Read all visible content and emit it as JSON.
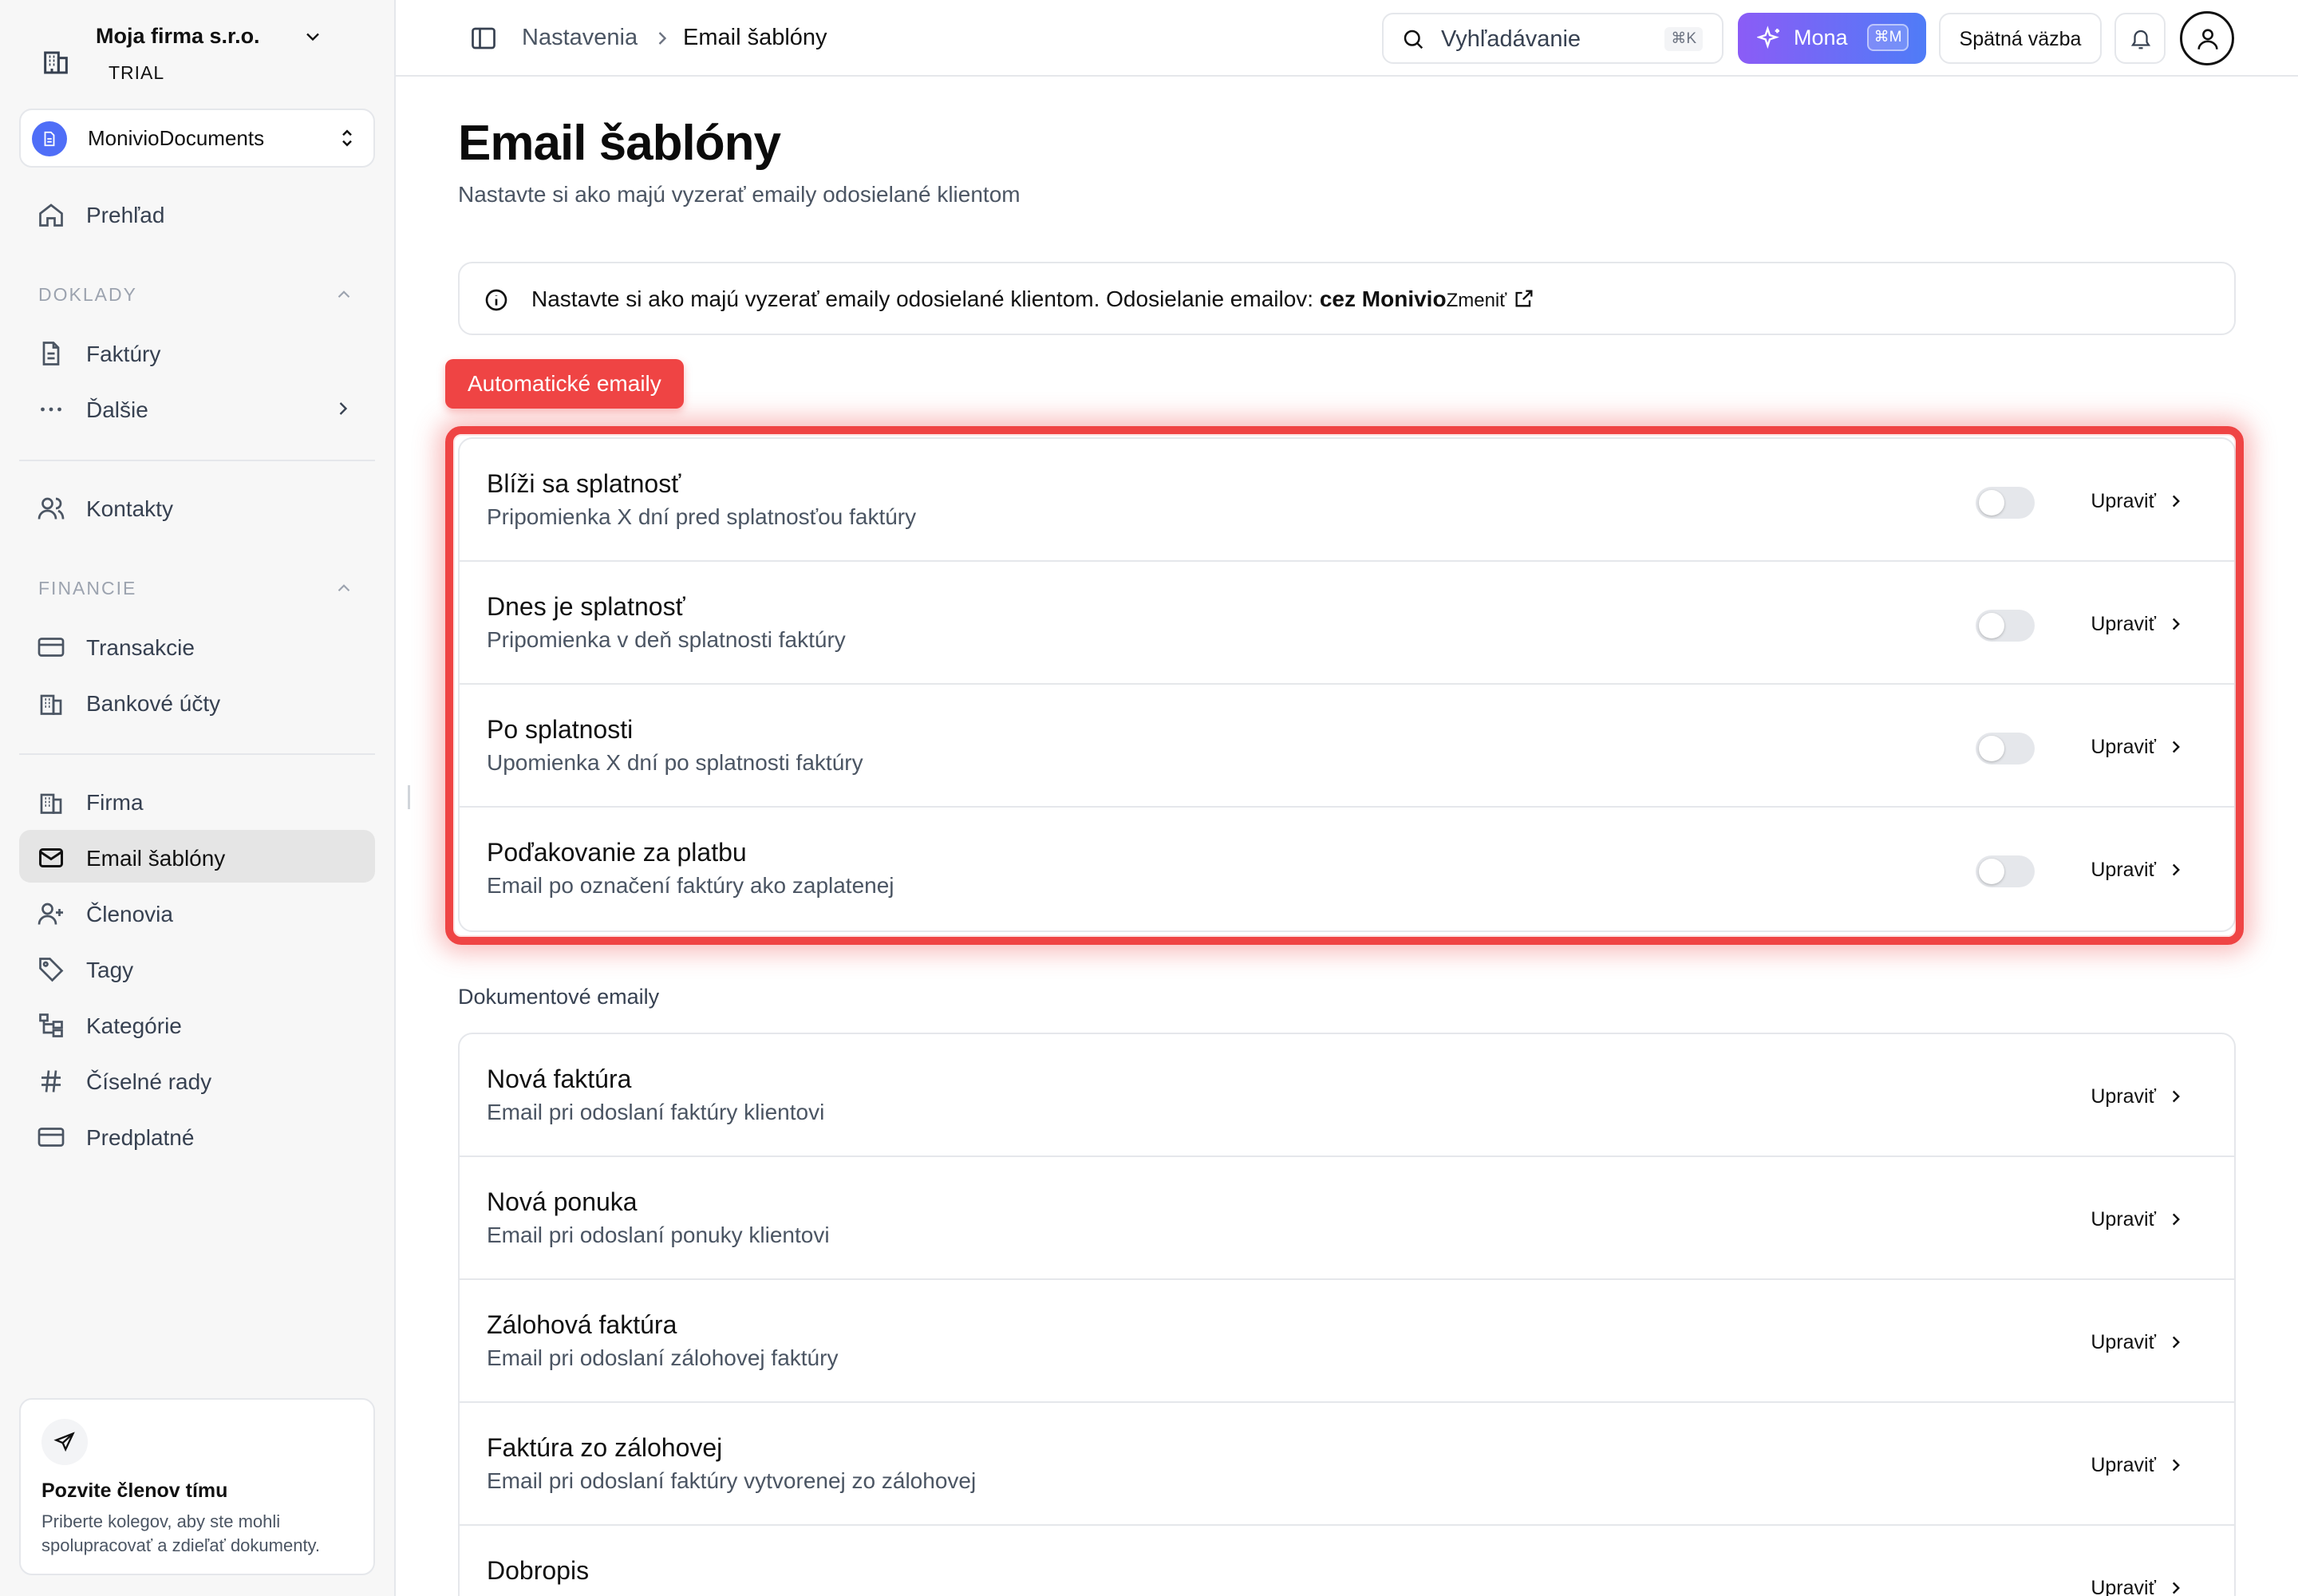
{
  "org": {
    "name": "Moja firma s.r.o.",
    "plan": "TRIAL"
  },
  "workspace": {
    "name": "MonivioDocuments"
  },
  "nav": {
    "overview": "Prehľad",
    "section_documents": "DOKLADY",
    "invoices": "Faktúry",
    "more": "Ďalšie",
    "contacts": "Kontakty",
    "section_finance": "FINANCIE",
    "transactions": "Transakcie",
    "bank_accounts": "Bankové účty",
    "company": "Firma",
    "email_templates": "Email šablóny",
    "members": "Členovia",
    "tags": "Tagy",
    "categories": "Kategórie",
    "number_series": "Číselné rady",
    "subscription": "Predplatné"
  },
  "invite": {
    "title": "Pozvite členov tímu",
    "description": "Priberte kolegov, aby ste mohli spolupracovať a zdieľať dokumenty."
  },
  "topbar": {
    "breadcrumb_parent": "Nastavenia",
    "breadcrumb_current": "Email šablóny",
    "search_placeholder": "Vyhľadávanie",
    "search_shortcut": "⌘K",
    "mona_label": "Mona",
    "mona_shortcut": "⌘M",
    "feedback_label": "Spätná väzba"
  },
  "page": {
    "title": "Email šablóny",
    "subtitle": "Nastavte si ako majú vyzerať emaily odosielané klientom",
    "info_text": "Nastavte si ako majú vyzerať emaily odosielané klientom. Odosielanie emailov: ",
    "info_strong": "cez Monivio",
    "info_link": "Zmeniť"
  },
  "auto_emails": {
    "badge": "Automatické emaily",
    "items": [
      {
        "title": "Blíži sa splatnosť",
        "description": "Pripomienka X dní pred splatnosťou faktúry",
        "enabled": false,
        "edit_label": "Upraviť"
      },
      {
        "title": "Dnes je splatnosť",
        "description": "Pripomienka v deň splatnosti faktúry",
        "enabled": false,
        "edit_label": "Upraviť"
      },
      {
        "title": "Po splatnosti",
        "description": "Upomienka X dní po splatnosti faktúry",
        "enabled": false,
        "edit_label": "Upraviť"
      },
      {
        "title": "Poďakovanie za platbu",
        "description": "Email po označení faktúry ako zaplatenej",
        "enabled": false,
        "edit_label": "Upraviť"
      }
    ]
  },
  "doc_emails": {
    "label": "Dokumentové emaily",
    "items": [
      {
        "title": "Nová faktúra",
        "description": "Email pri odoslaní faktúry klientovi",
        "edit_label": "Upraviť"
      },
      {
        "title": "Nová ponuka",
        "description": "Email pri odoslaní ponuky klientovi",
        "edit_label": "Upraviť"
      },
      {
        "title": "Zálohová faktúra",
        "description": "Email pri odoslaní zálohovej faktúry",
        "edit_label": "Upraviť"
      },
      {
        "title": "Faktúra zo zálohovej",
        "description": "Email pri odoslaní faktúry vytvorenej zo zálohovej",
        "edit_label": "Upraviť"
      },
      {
        "title": "Dobropis",
        "description": "",
        "edit_label": "Upraviť"
      }
    ]
  },
  "colors": {
    "accent_red": "#ef4444",
    "mona_from": "#8b5cf6",
    "mona_to": "#4f7cf7",
    "workspace_blue": "#4f6ef7"
  }
}
